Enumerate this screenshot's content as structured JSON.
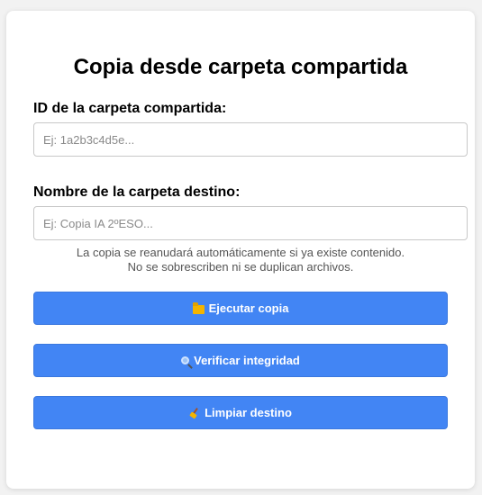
{
  "page": {
    "title": "Copia desde carpeta compartida"
  },
  "form": {
    "folder_id_label": "ID de la carpeta compartida:",
    "folder_id_placeholder": "Ej: 1a2b3c4d5e...",
    "folder_id_value": "",
    "dest_name_label": "Nombre de la carpeta destino:",
    "dest_name_placeholder": "Ej: Copia IA 2ºESO...",
    "dest_name_value": "",
    "note_line1": "La copia se reanudará automáticamente si ya existe contenido.",
    "note_line2": "No se sobrescriben ni se duplican archivos."
  },
  "actions": {
    "run_copy_label": "Ejecutar copia",
    "run_copy_icon": "folder-icon",
    "verify_label": "Verificar integridad",
    "verify_icon": "magnifier-icon",
    "clean_label": "Limpiar destino",
    "clean_icon": "broom-icon"
  },
  "colors": {
    "accent": "#4285f4",
    "background": "#f2f2f2",
    "card": "#ffffff"
  }
}
